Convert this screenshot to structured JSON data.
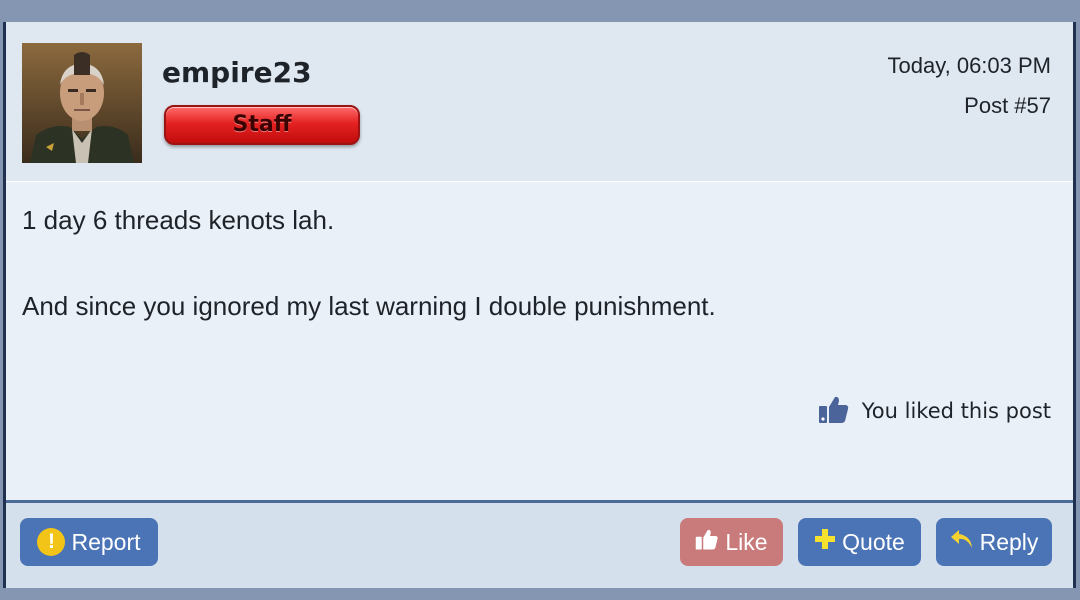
{
  "post": {
    "username": "empire23",
    "badge": "Staff",
    "date": "Today, 06:03 PM",
    "post_number": "Post #57",
    "body_lines": [
      "1 day 6 threads kenots lah.",
      "And since you ignored my last warning I double punishment."
    ],
    "liked_text": "You liked this post"
  },
  "actions": {
    "report": "Report",
    "like": "Like",
    "quote": "Quote",
    "reply": "Reply"
  },
  "colors": {
    "header_bg": "#dfe7f0",
    "body_bg": "#eaf0f7",
    "button_blue": "#4b74b7",
    "like_button": "#c97b7b",
    "staff_red": "#e42222",
    "report_icon": "#f2c417",
    "plus_icon": "#f5e12e",
    "reply_icon": "#f5d22e"
  },
  "icons": {
    "liked": "thumbs-up-icon",
    "report": "exclamation-circle-icon",
    "like": "thumbs-up-icon",
    "quote": "plus-icon",
    "reply": "reply-arrow-icon"
  }
}
